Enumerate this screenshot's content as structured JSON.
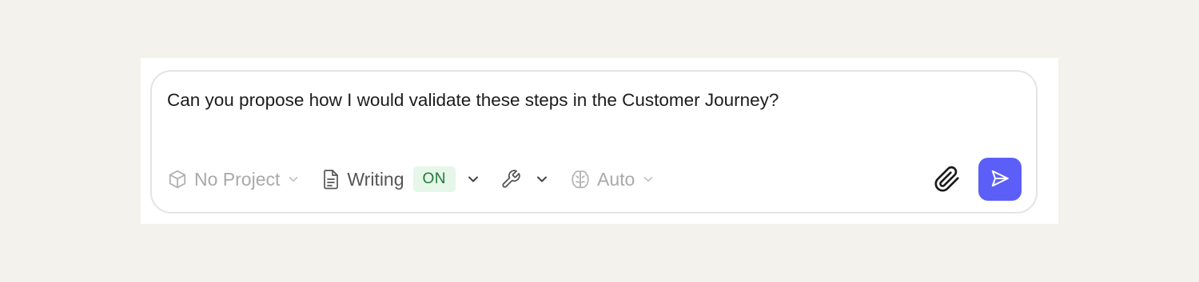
{
  "composer": {
    "message": "Can you propose how I would validate these steps in the Customer Journey?"
  },
  "toolbar": {
    "project": {
      "label": "No Project",
      "icon": "cube-icon"
    },
    "writing": {
      "label": "Writing",
      "status": "ON",
      "icon": "document-icon"
    },
    "tools": {
      "icon": "wrench-icon"
    },
    "model": {
      "label": "Auto",
      "icon": "brain-icon"
    },
    "attach": {
      "icon": "paperclip-icon"
    },
    "send": {
      "icon": "send-icon"
    }
  },
  "colors": {
    "background": "#f3f2ed",
    "accent": "#5b5ff7",
    "badge_bg": "#e6f6e9",
    "badge_text": "#1f7a3a"
  }
}
